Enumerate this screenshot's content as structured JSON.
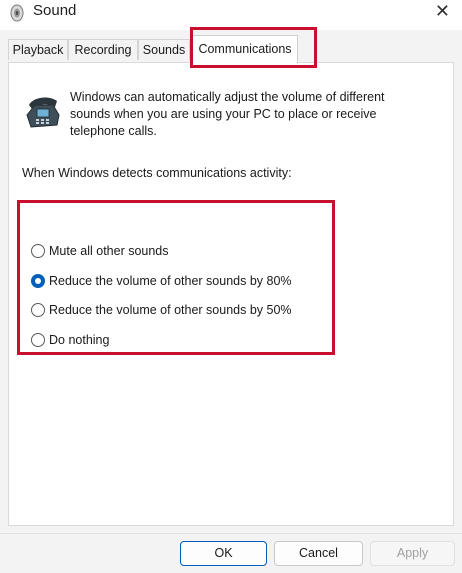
{
  "window": {
    "title": "Sound",
    "close_glyph": "✕",
    "icon": "speaker-icon"
  },
  "tabs": [
    {
      "label": "Playback"
    },
    {
      "label": "Recording"
    },
    {
      "label": "Sounds"
    },
    {
      "label": "Communications",
      "selected": true
    }
  ],
  "communications": {
    "icon": "telephone-icon",
    "description": "Windows can automatically adjust the volume of different sounds when you are using your PC to place or receive telephone calls.",
    "detects_label": "When Windows detects communications activity:",
    "options": [
      {
        "label": "Mute all other sounds",
        "selected": false
      },
      {
        "label": "Reduce the volume of other sounds by 80%",
        "selected": true
      },
      {
        "label": "Reduce the volume of other sounds by 50%",
        "selected": false
      },
      {
        "label": "Do nothing",
        "selected": false
      }
    ]
  },
  "buttons": {
    "ok": "OK",
    "cancel": "Cancel",
    "apply": "Apply"
  },
  "colors": {
    "highlight": "#c8102e",
    "accent": "#005fb8"
  }
}
